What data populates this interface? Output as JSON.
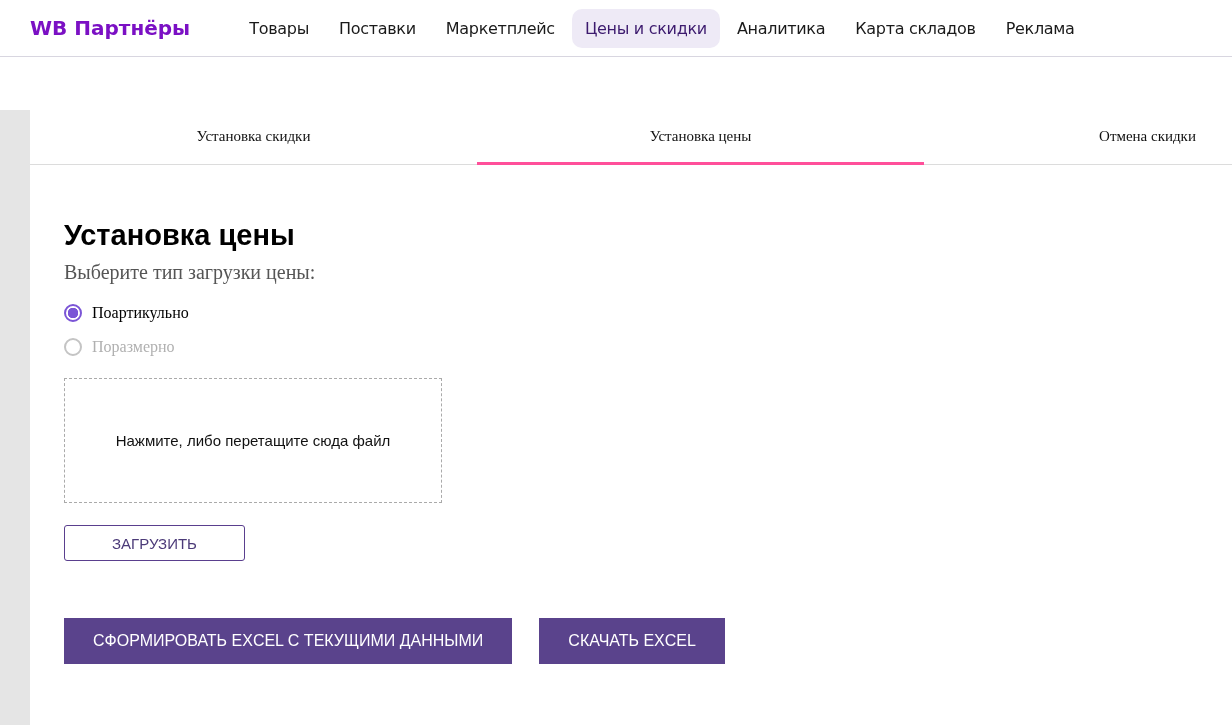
{
  "header": {
    "logo": "WB Партнёры",
    "nav": [
      {
        "label": "Товары",
        "selected": false
      },
      {
        "label": "Поставки",
        "selected": false
      },
      {
        "label": "Маркетплейс",
        "selected": false
      },
      {
        "label": "Цены и скидки",
        "selected": true
      },
      {
        "label": "Аналитика",
        "selected": false
      },
      {
        "label": "Карта складов",
        "selected": false
      },
      {
        "label": "Реклама",
        "selected": false
      }
    ]
  },
  "tabs": [
    {
      "label": "Установка скидки",
      "selected": false
    },
    {
      "label": "Установка цены",
      "selected": true
    },
    {
      "label": "Отмена скидки",
      "selected": false
    }
  ],
  "title": "Установка цены",
  "subtitle": "Выберите тип загрузки цены:",
  "options": [
    {
      "label": "Поартикульно",
      "selected": true,
      "disabled": false
    },
    {
      "label": "Поразмерно",
      "selected": false,
      "disabled": true
    }
  ],
  "dropzone": {
    "text": "Нажмите, либо перетащите сюда файл"
  },
  "upload_button": "ЗАГРУЗИТЬ",
  "actions": [
    "СФОРМИРОВАТЬ EXCEL С ТЕКУЩИМИ ДАННЫМИ",
    "СКАЧАТЬ EXCEL"
  ]
}
